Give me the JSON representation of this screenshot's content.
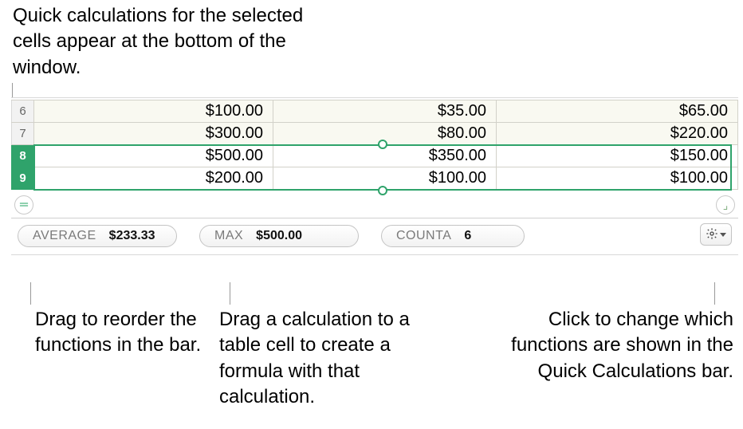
{
  "callouts": {
    "top": "Quick calculations for the selected cells appear at the bottom of the window.",
    "reorder": "Drag to reorder the functions in the bar.",
    "drag_calc": "Drag a calculation to a table cell to create a formula with that calculation.",
    "gear": "Click to change which functions are shown in the Quick Calculations bar."
  },
  "rows": [
    {
      "num": "6",
      "a": "$100.00",
      "b": "$35.00",
      "c": "$65.00",
      "selected": false
    },
    {
      "num": "7",
      "a": "$300.00",
      "b": "$80.00",
      "c": "$220.00",
      "selected": false
    },
    {
      "num": "8",
      "a": "$500.00",
      "b": "$350.00",
      "c": "$150.00",
      "selected": true
    },
    {
      "num": "9",
      "a": "$200.00",
      "b": "$100.00",
      "c": "$100.00",
      "selected": true
    }
  ],
  "calcs": {
    "average": {
      "label": "AVERAGE",
      "value": "$233.33"
    },
    "max": {
      "label": "MAX",
      "value": "$500.00"
    },
    "counta": {
      "label": "COUNTA",
      "value": "6"
    }
  },
  "icons": {
    "equals": "＝",
    "corner": "⌟"
  }
}
